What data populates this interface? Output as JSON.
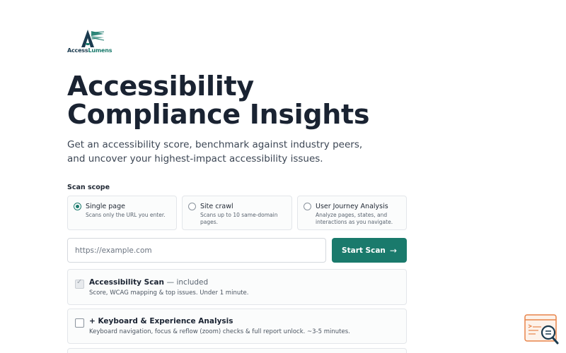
{
  "brand": {
    "name_part1": "Access",
    "name_part2": "Lumens"
  },
  "hero": {
    "title_line1": "Accessibility",
    "title_line2": "Compliance Insights",
    "subtitle": "Get an accessibility score, benchmark against industry peers, and uncover your highest-impact accessibility issues."
  },
  "scan_scope": {
    "label": "Scan scope",
    "options": [
      {
        "title": "Single page",
        "description": "Scans only the URL you enter.",
        "selected": true
      },
      {
        "title": "Site crawl",
        "description": "Scans up to 10 same-domain pages.",
        "selected": false
      },
      {
        "title": "User Journey Analysis",
        "description": "Analyze pages, states, and interactions as you navigate.",
        "selected": false
      }
    ]
  },
  "url_input": {
    "placeholder": "https://example.com",
    "value": ""
  },
  "start_button": {
    "label": "Start Scan",
    "icon": "arrow-right-icon"
  },
  "addons": [
    {
      "title": "Accessibility Scan",
      "note": "— included",
      "description": "Score, WCAG mapping & top issues. Under 1 minute.",
      "checked": true,
      "disabled": true
    },
    {
      "title": "+ Keyboard & Experience Analysis",
      "note": "",
      "description": "Keyboard navigation, focus & reflow (zoom) checks & full report unlock. ~3-5 minutes.",
      "checked": false,
      "disabled": false
    }
  ],
  "colors": {
    "accent": "#1a7a6c",
    "brand_dark": "#1b3b4f",
    "help_widget": "#e8844a"
  }
}
